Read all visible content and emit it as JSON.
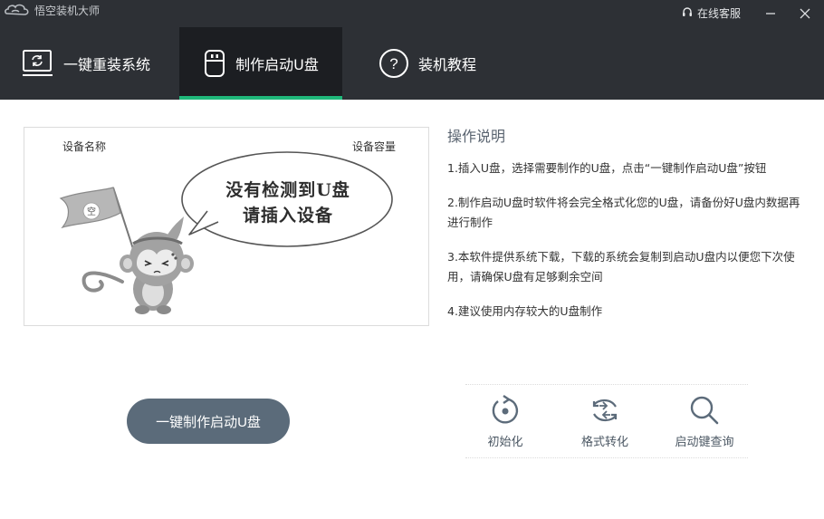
{
  "app": {
    "title": "悟空装机大师",
    "support_label": "在线客服"
  },
  "tabs": [
    {
      "label": "一键重装系统",
      "icon": "monitor-refresh-icon",
      "active": false
    },
    {
      "label": "制作启动U盘",
      "icon": "usb-drive-icon",
      "active": true
    },
    {
      "label": "装机教程",
      "icon": "question-circle-icon",
      "active": false
    }
  ],
  "device_panel": {
    "col_name": "设备名称",
    "col_capacity": "设备容量",
    "empty_line1": "没有检测到U盘",
    "empty_line2": "请插入设备",
    "flag_text": "空"
  },
  "instructions": {
    "title": "操作说明",
    "items": [
      "1.插入U盘，选择需要制作的U盘，点击“一键制作启动U盘”按钮",
      "2.制作启动U盘时软件将会完全格式化您的U盘，请备份好U盘内数据再进行制作",
      "3.本软件提供系统下载，下载的系统会复制到启动U盘内以便您下次使用，请确保U盘有足够剩余空间",
      "4.建议使用内存较大的U盘制作"
    ]
  },
  "actions": {
    "make_usb": "一键制作启动U盘"
  },
  "tools": [
    {
      "label": "初始化",
      "icon": "reset-icon"
    },
    {
      "label": "格式转化",
      "icon": "convert-icon"
    },
    {
      "label": "启动键查询",
      "icon": "search-icon"
    }
  ],
  "colors": {
    "header_bg": "#2d3035",
    "active_tab_bg": "#1c1e22",
    "accent_green": "#1fb87a",
    "button_bg": "#5b6b7a"
  }
}
